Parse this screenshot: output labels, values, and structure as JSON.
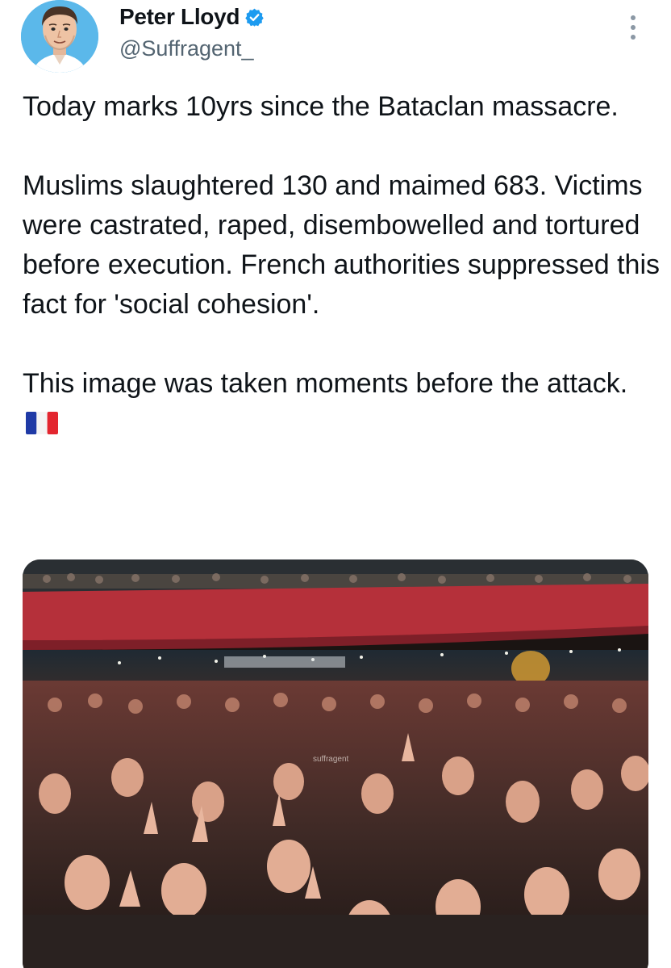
{
  "author": {
    "name": "Peter Lloyd",
    "handle": "@Suffragent_",
    "verified": true,
    "avatar_icon": "cartoon-avatar-icon",
    "avatar_bg": "#5bb8ea"
  },
  "post": {
    "paragraphs": [
      "Today marks 10yrs since the Bataclan massacre.",
      "Muslims slaughtered 130 and maimed 683. Victims were castrated, raped, disembowelled and tortured before execution. French authorities suppressed this fact for 'social cohesion'.",
      "This image was taken moments before the attack."
    ],
    "trailing_emoji": "french-flag-icon"
  },
  "media": {
    "watermark": "suffragent",
    "icon": "concert-crowd-photo"
  },
  "colors": {
    "verified": "#1d9bf0",
    "text": "#0f1419",
    "secondary": "#536471",
    "venue_balcony": "#b5303a"
  }
}
